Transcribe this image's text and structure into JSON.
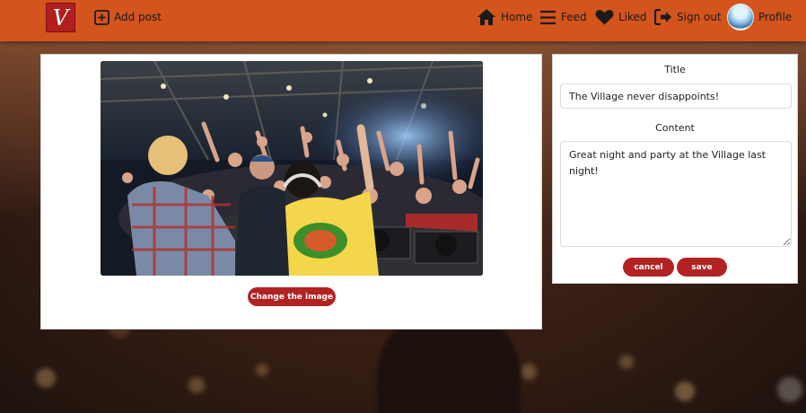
{
  "navbar": {
    "logo_letter": "V",
    "add_post_label": "Add post",
    "home_label": "Home",
    "feed_label": "Feed",
    "liked_label": "Liked",
    "signout_label": "Sign out",
    "profile_label": "Profile"
  },
  "post": {
    "change_image_label": "Change the image"
  },
  "form": {
    "title_label": "Title",
    "title_value": "The Village never disappoints!",
    "content_label": "Content",
    "content_value": "Great night and party at the Village last night!",
    "cancel_label": "cancel",
    "save_label": "save"
  },
  "colors": {
    "navbar": "#d4541d",
    "button": "#b22222",
    "logo": "#b01e1e"
  },
  "icons": [
    "plus-square-icon",
    "home-icon",
    "feed-icon",
    "heart-icon",
    "sign-out-icon",
    "avatar"
  ]
}
